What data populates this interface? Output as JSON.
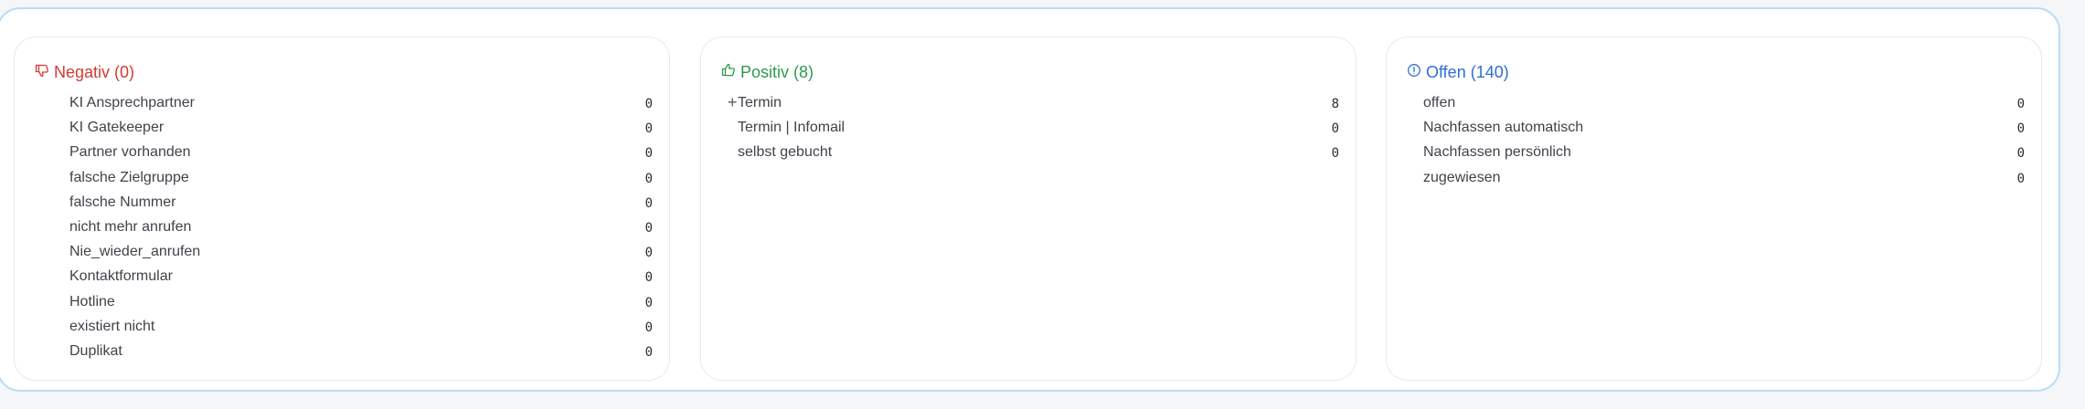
{
  "colors": {
    "negative": "#d03b34",
    "positive": "#2e9a4c",
    "open": "#2f6fd6"
  },
  "panels": {
    "negative": {
      "icon": "thumbs-down-icon",
      "title": "Negativ (0)",
      "items": [
        {
          "label": "KI Ansprechpartner",
          "count": "0"
        },
        {
          "label": "KI Gatekeeper",
          "count": "0"
        },
        {
          "label": "Partner vorhanden",
          "count": "0"
        },
        {
          "label": "falsche Zielgruppe",
          "count": "0"
        },
        {
          "label": "falsche Nummer",
          "count": "0"
        },
        {
          "label": "nicht mehr anrufen",
          "count": "0"
        },
        {
          "label": "Nie_wieder_anrufen",
          "count": "0"
        },
        {
          "label": "Kontaktformular",
          "count": "0"
        },
        {
          "label": "Hotline",
          "count": "0"
        },
        {
          "label": "existiert nicht",
          "count": "0"
        },
        {
          "label": "Duplikat",
          "count": "0"
        }
      ]
    },
    "positive": {
      "icon": "thumbs-up-icon",
      "title": "Positiv (8)",
      "items": [
        {
          "label": "Termin",
          "count": "8",
          "expand_icon": "plus-icon"
        },
        {
          "label": "Termin | Infomail",
          "count": "0"
        },
        {
          "label": "selbst gebucht",
          "count": "0"
        }
      ]
    },
    "open": {
      "icon": "info-circle-icon",
      "title": "Offen (140)",
      "items": [
        {
          "label": "offen",
          "count": "0"
        },
        {
          "label": "Nachfassen automatisch",
          "count": "0"
        },
        {
          "label": "Nachfassen persönlich",
          "count": "0"
        },
        {
          "label": "zugewiesen",
          "count": "0"
        }
      ]
    }
  }
}
